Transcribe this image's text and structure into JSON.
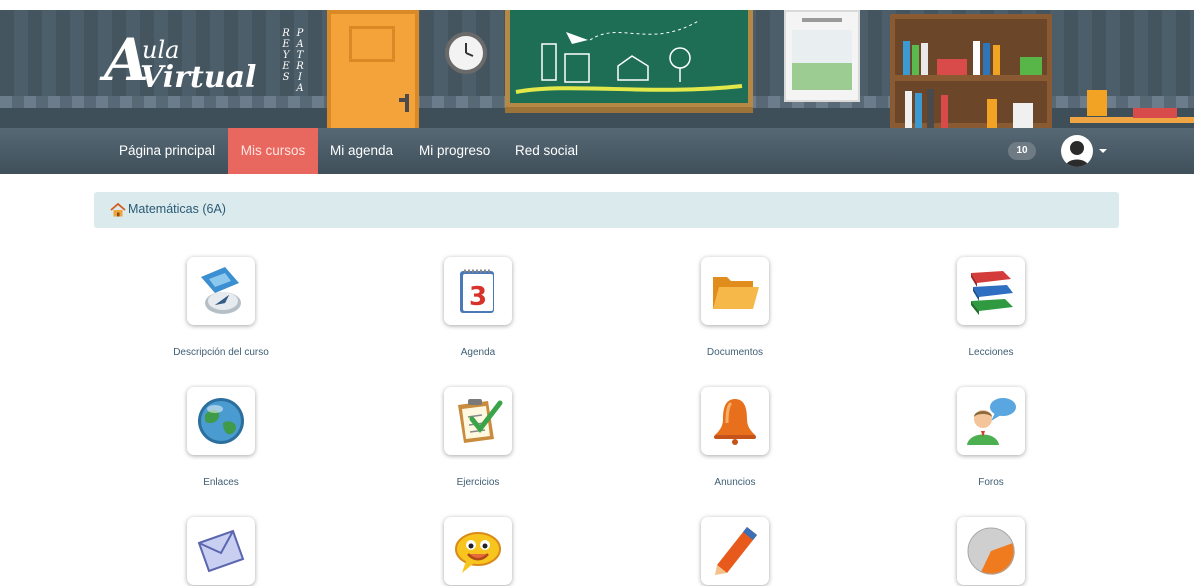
{
  "logo": {
    "a": "A",
    "aula": "ula",
    "virtual": "Virtual",
    "col1": "REYES",
    "col2": "PATRIA"
  },
  "nav": {
    "items": [
      {
        "label": "Página principal"
      },
      {
        "label": "Mis cursos",
        "active": true
      },
      {
        "label": "Mi agenda"
      },
      {
        "label": "Mi progreso"
      },
      {
        "label": "Red social"
      }
    ],
    "active_color": "#e8685f",
    "notification_count": "10"
  },
  "breadcrumb": {
    "home_icon": "home-icon",
    "course": "Matemáticas (6A)"
  },
  "tools": [
    {
      "label": "Descripción del curso",
      "icon": "compass-icon"
    },
    {
      "label": "Agenda",
      "icon": "calendar-icon"
    },
    {
      "label": "Documentos",
      "icon": "folder-icon"
    },
    {
      "label": "Lecciones",
      "icon": "books-icon"
    },
    {
      "label": "Enlaces",
      "icon": "globe-icon"
    },
    {
      "label": "Ejercicios",
      "icon": "clipboard-check-icon"
    },
    {
      "label": "Anuncios",
      "icon": "bell-icon"
    },
    {
      "label": "Foros",
      "icon": "user-chat-icon"
    },
    {
      "label": "",
      "icon": "envelope-icon"
    },
    {
      "label": "",
      "icon": "chat-face-icon"
    },
    {
      "label": "",
      "icon": "pen-icon"
    },
    {
      "label": "",
      "icon": "orange-disc-icon"
    }
  ]
}
